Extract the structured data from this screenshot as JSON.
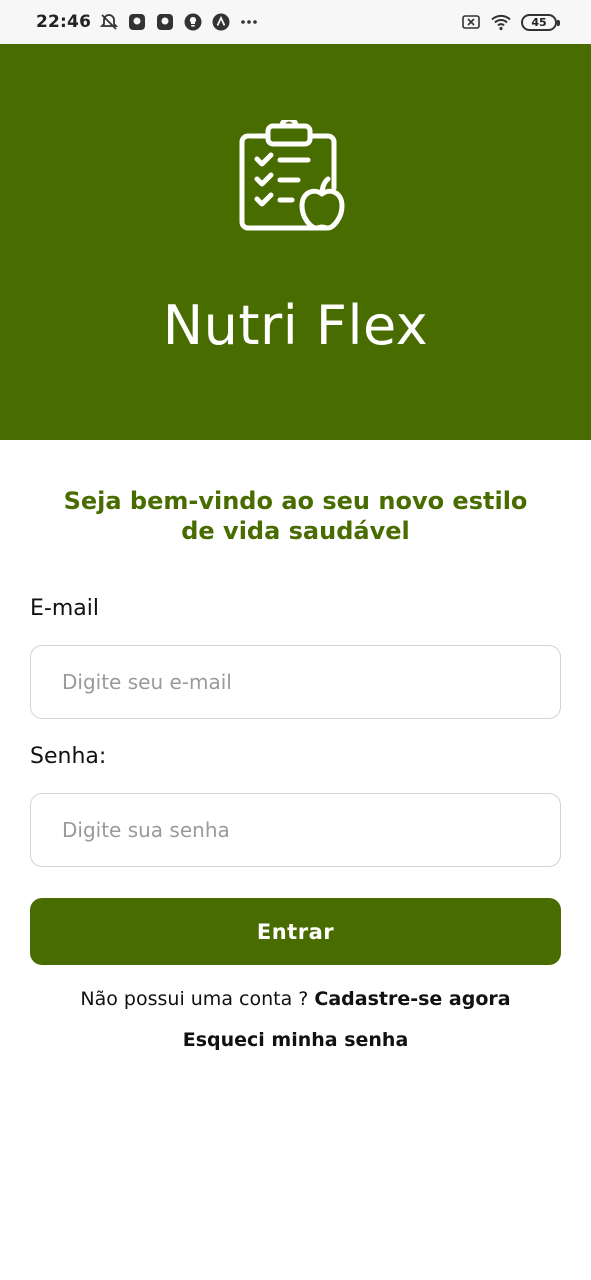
{
  "status_bar": {
    "time": "22:46",
    "battery": "45",
    "icons_left": [
      "alarm-off-icon",
      "app-icon",
      "app-icon",
      "bulb-icon",
      "nav-icon",
      "more-dots-icon"
    ],
    "icons_right": [
      "sim-off-icon",
      "wifi-icon",
      "battery-icon"
    ]
  },
  "hero": {
    "title": "Nutri Flex",
    "logo_icon": "clipboard-apple-icon",
    "background": "#486c00"
  },
  "welcome": {
    "line1": "Seja bem-vindo ao seu novo estilo",
    "line2": "de vida saudável"
  },
  "form": {
    "email_label": "E-mail",
    "email_placeholder": "Digite seu e-mail",
    "email_value": "",
    "password_label": "Senha:",
    "password_placeholder": "Digite sua senha",
    "password_value": "",
    "submit_label": "Entrar"
  },
  "links": {
    "no_account": "Não possui uma conta ?",
    "signup": "Cadastre-se agora",
    "forgot": "Esqueci minha senha"
  },
  "colors": {
    "accent": "#486c00",
    "input_border": "#d3d3d3",
    "placeholder": "#9a9a9a"
  }
}
